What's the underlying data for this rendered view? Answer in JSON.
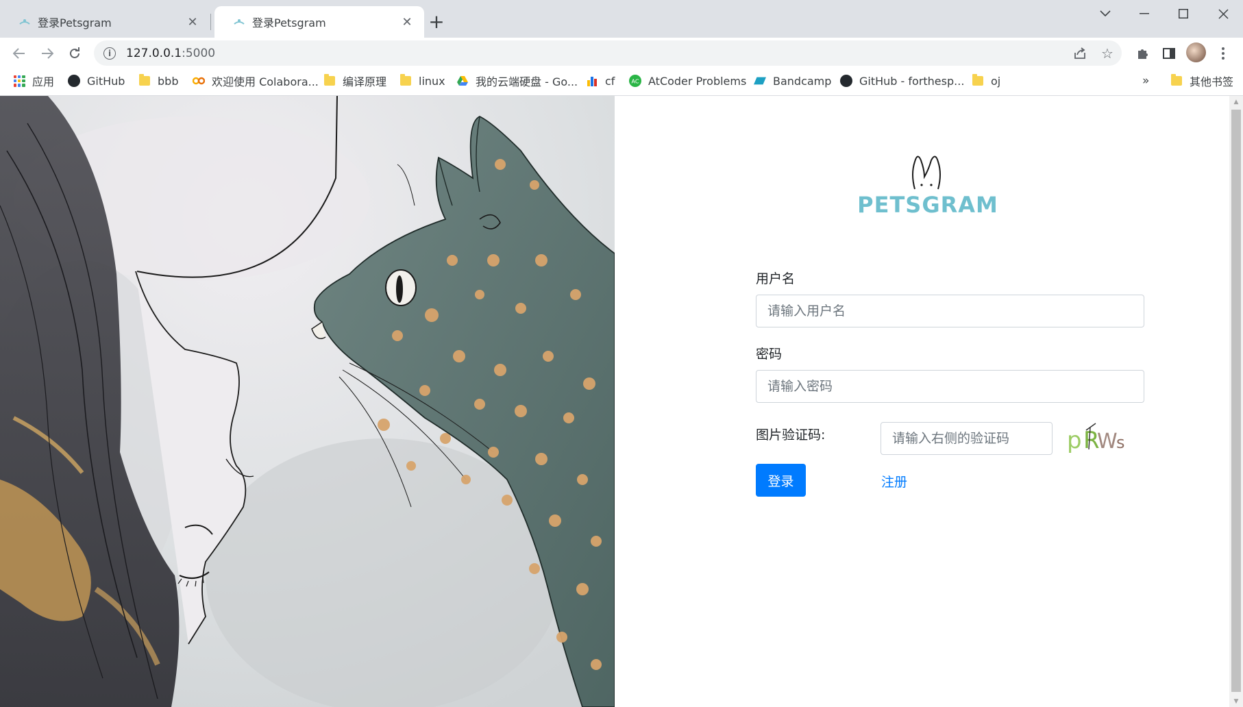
{
  "browser": {
    "tabs": [
      {
        "title": "登录Petsgram",
        "active": false
      },
      {
        "title": "登录Petsgram",
        "active": true
      }
    ],
    "address": {
      "host": "127.0.0.1",
      "port": ":5000"
    },
    "bookmarks": [
      {
        "label": "应用",
        "icon": "apps-grid-icon"
      },
      {
        "label": "GitHub",
        "icon": "github-icon"
      },
      {
        "label": "bbb",
        "icon": "folder-icon"
      },
      {
        "label": "欢迎使用 Colabora...",
        "icon": "colab-icon"
      },
      {
        "label": "编译原理",
        "icon": "folder-icon"
      },
      {
        "label": "linux",
        "icon": "folder-icon"
      },
      {
        "label": "我的云端硬盘 - Go...",
        "icon": "google-drive-icon"
      },
      {
        "label": "cf",
        "icon": "codeforces-icon"
      },
      {
        "label": "AtCoder Problems",
        "icon": "atcoder-icon"
      },
      {
        "label": "Bandcamp",
        "icon": "bandcamp-icon"
      },
      {
        "label": "GitHub - forthesp...",
        "icon": "github-icon"
      },
      {
        "label": "oj",
        "icon": "folder-icon"
      }
    ],
    "overflow_label": "»",
    "other_bookmarks": "其他书签"
  },
  "page": {
    "logo_text": "PETSGRAM",
    "username": {
      "label": "用户名",
      "placeholder": "请输入用户名"
    },
    "password": {
      "label": "密码",
      "placeholder": "请输入密码"
    },
    "captcha": {
      "label": "图片验证码:",
      "placeholder": "请输入右侧的验证码",
      "image_text": "pRWs"
    },
    "login_button": "登录",
    "register_link": "注册"
  },
  "colors": {
    "primary": "#007bff",
    "logo": "#6fbfce",
    "tabstrip": "#dee1e6"
  }
}
